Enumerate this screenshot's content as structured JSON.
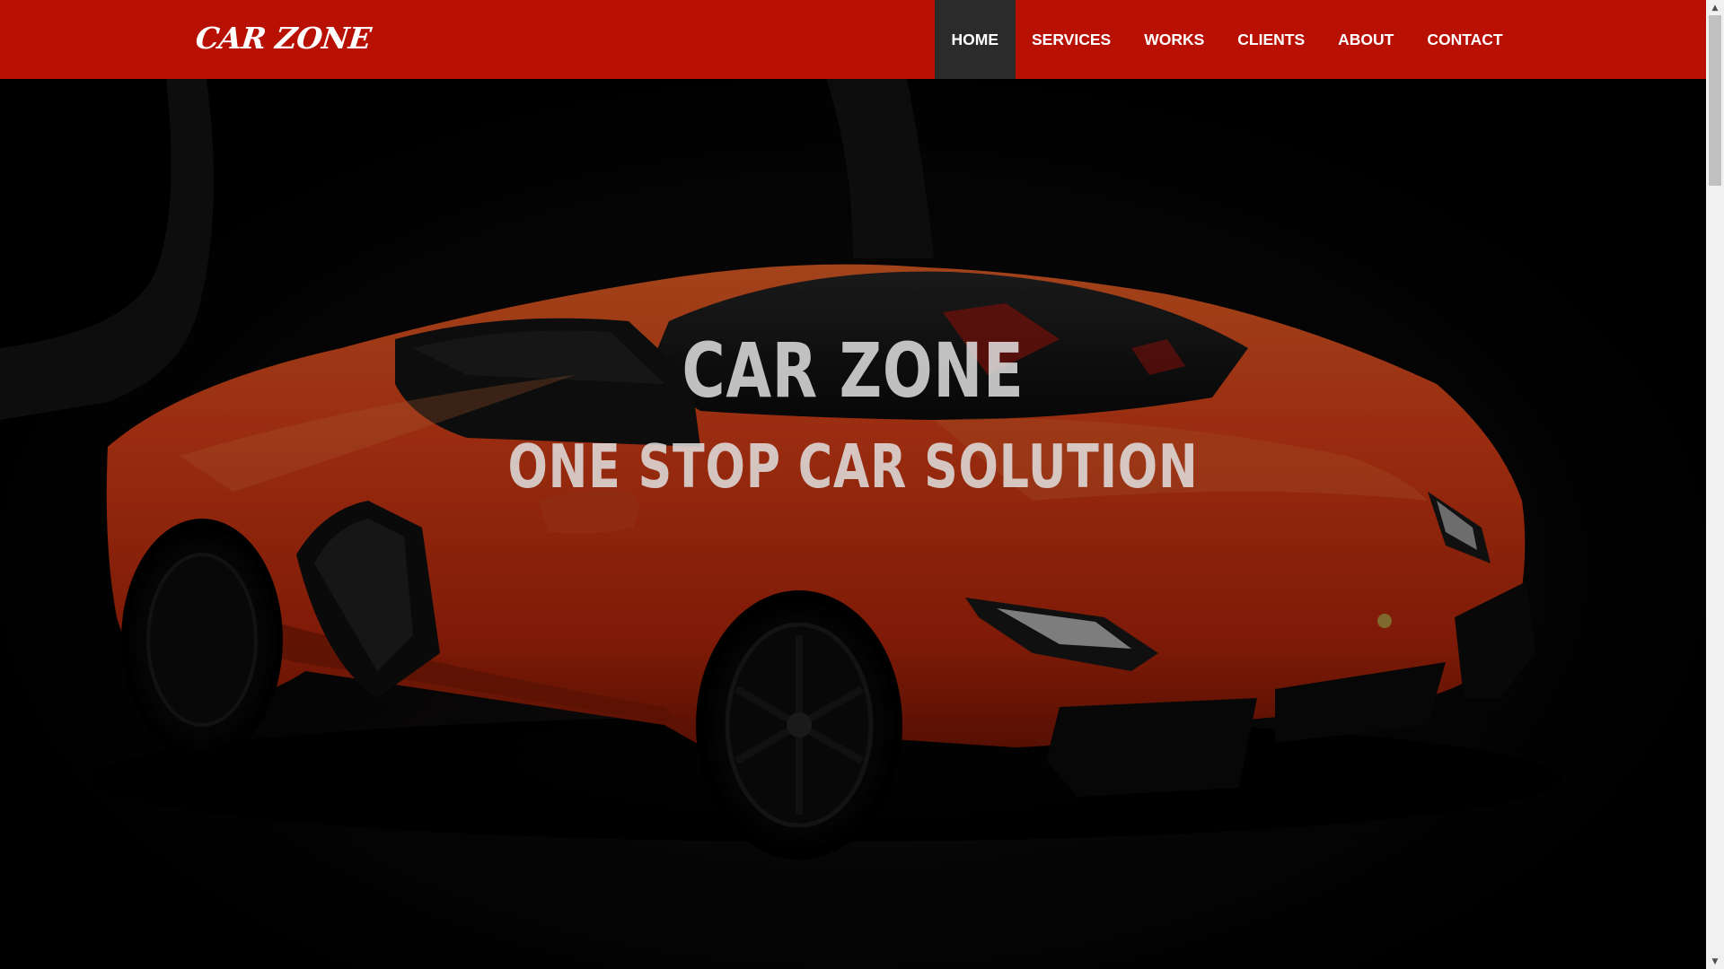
{
  "brand": {
    "name": "CAR ZONE"
  },
  "nav": {
    "items": [
      {
        "label": "HOME",
        "active": true
      },
      {
        "label": "SERVICES",
        "active": false
      },
      {
        "label": "WORKS",
        "active": false
      },
      {
        "label": "CLIENTS",
        "active": false
      },
      {
        "label": "ABOUT",
        "active": false
      },
      {
        "label": "CONTACT",
        "active": false
      }
    ]
  },
  "hero": {
    "title": "CAR ZONE",
    "subtitle": "ONE STOP CAR SOLUTION",
    "image": "orange-sports-car"
  },
  "colors": {
    "navbar": "#b81104",
    "nav_active": "#2c2b2b",
    "text": "#ffffff"
  },
  "scrollbar": {
    "up_icon": "scroll-up-arrow-icon",
    "down_icon": "scroll-down-arrow-icon"
  }
}
